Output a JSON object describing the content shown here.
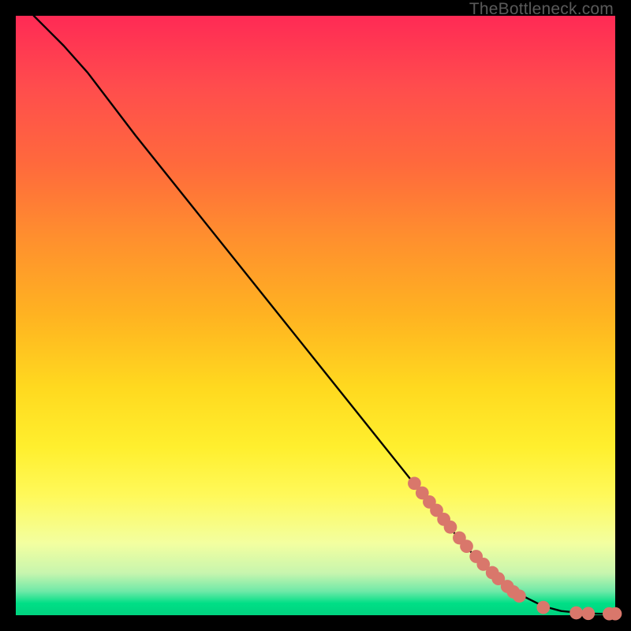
{
  "watermark": "TheBottleneck.com",
  "chart_data": {
    "type": "line",
    "title": "",
    "xlabel": "",
    "ylabel": "",
    "xlim": [
      0,
      100
    ],
    "ylim": [
      0,
      100
    ],
    "grid": false,
    "curve": {
      "name": "bottleneck-curve",
      "color": "#000000",
      "points_xy": [
        [
          3,
          100
        ],
        [
          5,
          98
        ],
        [
          8,
          95
        ],
        [
          12,
          90.5
        ],
        [
          20,
          80
        ],
        [
          30,
          67.5
        ],
        [
          40,
          55
        ],
        [
          50,
          42.5
        ],
        [
          60,
          30
        ],
        [
          70,
          17.5
        ],
        [
          75,
          11.5
        ],
        [
          80,
          6.5
        ],
        [
          85,
          3
        ],
        [
          88,
          1.5
        ],
        [
          91,
          0.7
        ],
        [
          95,
          0.3
        ],
        [
          100,
          0.2
        ]
      ]
    },
    "markers": {
      "name": "highlighted-points",
      "color": "#d9776b",
      "radius_pct": 1.1,
      "points_xy": [
        [
          66.5,
          22.0
        ],
        [
          67.8,
          20.4
        ],
        [
          69.0,
          18.9
        ],
        [
          70.2,
          17.5
        ],
        [
          71.4,
          16.0
        ],
        [
          72.5,
          14.7
        ],
        [
          74.0,
          12.9
        ],
        [
          75.2,
          11.5
        ],
        [
          76.8,
          9.8
        ],
        [
          78.0,
          8.5
        ],
        [
          79.5,
          7.1
        ],
        [
          80.5,
          6.1
        ],
        [
          82.0,
          4.8
        ],
        [
          83.0,
          3.9
        ],
        [
          84.0,
          3.2
        ],
        [
          88.0,
          1.3
        ],
        [
          93.5,
          0.4
        ],
        [
          95.5,
          0.3
        ],
        [
          99.0,
          0.25
        ],
        [
          100.0,
          0.25
        ]
      ]
    }
  }
}
